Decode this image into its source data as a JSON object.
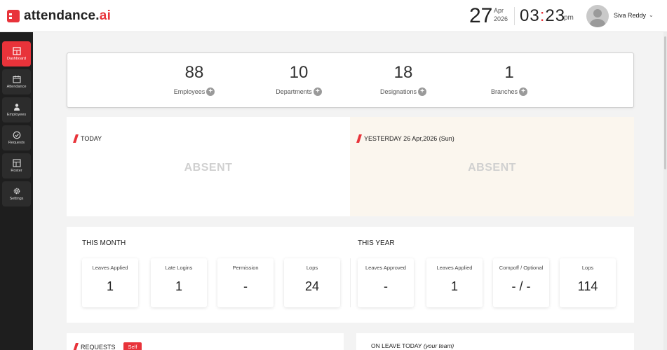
{
  "header": {
    "logo_main": "attendance.",
    "logo_accent": "ai",
    "date_day": "27",
    "date_month": "Apr",
    "date_year": "2026",
    "time_hours": "03",
    "time_minutes": "23",
    "time_ampm": "pm",
    "user_name": "Siva Reddy"
  },
  "sidebar": {
    "items": [
      {
        "label": "Dashboard",
        "icon": "dashboard-icon",
        "active": true
      },
      {
        "label": "Attendance",
        "icon": "calendar-icon"
      },
      {
        "label": "Employees",
        "icon": "people-icon"
      },
      {
        "label": "Requests",
        "icon": "check-circle-icon"
      },
      {
        "label": "Roster",
        "icon": "roster-icon"
      },
      {
        "label": "Settings",
        "icon": "gear-icon"
      }
    ]
  },
  "stats": [
    {
      "value": "88",
      "label": "Employees"
    },
    {
      "value": "10",
      "label": "Departments"
    },
    {
      "value": "18",
      "label": "Designations"
    },
    {
      "value": "1",
      "label": "Branches"
    }
  ],
  "today": {
    "title": "TODAY",
    "status": "ABSENT"
  },
  "yesterday": {
    "title": "YESTERDAY 26 Apr,2026 (Sun)",
    "status": "ABSENT"
  },
  "this_month": {
    "title": "THIS MONTH",
    "items": [
      {
        "label": "Leaves Applied",
        "value": "1"
      },
      {
        "label": "Late Logins",
        "value": "1"
      },
      {
        "label": "Permission",
        "value": "-"
      },
      {
        "label": "Lops",
        "value": "24"
      }
    ]
  },
  "this_year": {
    "title": "THIS YEAR",
    "items": [
      {
        "label": "Leaves Approved",
        "value": "-"
      },
      {
        "label": "Leaves Applied",
        "value": "1"
      },
      {
        "label": "Compoff / Optional",
        "value": "- / -"
      },
      {
        "label": "Lops",
        "value": "114"
      }
    ]
  },
  "requests": {
    "title": "REQUESTS",
    "badge": "Self"
  },
  "on_leave": {
    "title": "ON LEAVE TODAY",
    "subtitle": "(your team)"
  },
  "colors": {
    "accent": "#e8333a",
    "sidebar": "#1e1e1e",
    "yesterday_bg": "#fbf6ee"
  }
}
